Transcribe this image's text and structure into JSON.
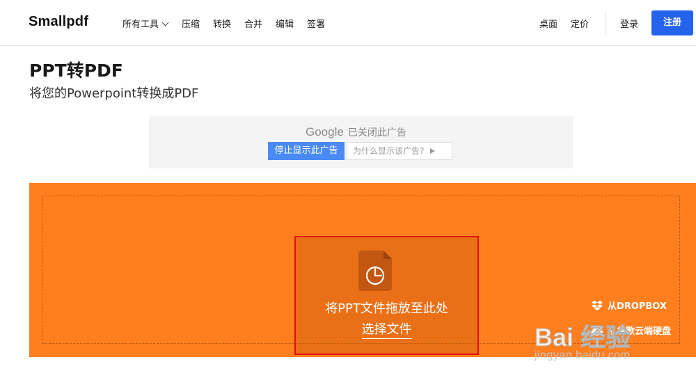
{
  "header": {
    "logo": "Smallpdf",
    "nav": {
      "all_tools": "所有工具",
      "compress": "压缩",
      "convert": "转换",
      "merge": "合并",
      "edit": "编辑",
      "sign": "签署"
    },
    "desktop": "桌面",
    "pricing": "定价",
    "login": "登录",
    "signup": "注册"
  },
  "page": {
    "title": "PPT转PDF",
    "subtitle": "将您的Powerpoint转换成PDF"
  },
  "ad": {
    "google": "Google",
    "closed_text": "已关闭此广告",
    "stop_button": "停止显示此广告",
    "why_button": "为什么显示该广告?"
  },
  "upload": {
    "drop_text": "将PPT文件拖放至此处",
    "choose_file": "选择文件",
    "from_dropbox": "从DROPBOX",
    "from_google_drive": "从谷歌云端硬盘",
    "bg_color": "#ff7f1f"
  },
  "watermark": {
    "main": "Bai  经验",
    "url": "jingyan.baidu.com"
  },
  "colors": {
    "primary": "#2463eb",
    "ad_button": "#4a8af4",
    "highlight_border": "#e01010"
  }
}
